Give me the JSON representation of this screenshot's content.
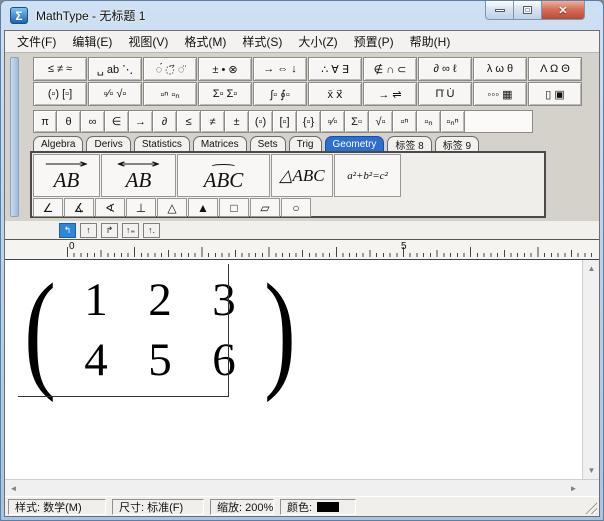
{
  "window": {
    "title": "MathType - 无标题 1"
  },
  "icons": {
    "app": "Σ",
    "close": "✕",
    "scroll_up": "▲",
    "scroll_down": "▼",
    "scroll_left": "◄",
    "scroll_right": "►"
  },
  "menu": {
    "items": [
      "文件(F)",
      "编辑(E)",
      "视图(V)",
      "格式(M)",
      "样式(S)",
      "大小(Z)",
      "预置(P)",
      "帮助(H)"
    ]
  },
  "toolbar": {
    "row1": [
      "≤ ≠ ≈",
      "␣ ab ⋱",
      "◌́ ◌⃗ ◌̈",
      "± • ⊗",
      "→ ⇔ ↓",
      "∴ ∀ ∃",
      "∉ ∩ ⊂",
      "∂ ∞ ℓ",
      "λ ω θ",
      "Λ Ω Θ"
    ],
    "row2": [
      "(▫) [▫]",
      "▫∕▫ √▫",
      "▫ⁿ ▫ₙ",
      "Σ▫ Σ▫",
      "∫▫ ∮▫",
      "x̄ x⃗",
      "→ ⇌",
      "Π̇ U̇",
      "◦◦◦ ▦",
      "▯ ▣"
    ],
    "row3": [
      "π",
      "θ",
      "∞",
      "∈",
      "→",
      "∂",
      "≤",
      "≠",
      "±",
      "(▫)",
      "[▫]",
      "{▫}",
      "▫∕▫",
      "Σ▫",
      "√▫",
      "▫ⁿ",
      "▫ₙ",
      "▫ₙⁿ"
    ],
    "tabs": [
      {
        "label": "Algebra",
        "active": false
      },
      {
        "label": "Derivs",
        "active": false
      },
      {
        "label": "Statistics",
        "active": false
      },
      {
        "label": "Matrices",
        "active": false
      },
      {
        "label": "Sets",
        "active": false
      },
      {
        "label": "Trig",
        "active": false
      },
      {
        "label": "Geometry",
        "active": true
      },
      {
        "label": "标签 8",
        "active": false
      },
      {
        "label": "标签 9",
        "active": false
      }
    ],
    "templates_large": [
      {
        "accent": "⟶",
        "base": "AB"
      },
      {
        "accent": "⟷",
        "base": "AB"
      },
      {
        "accent": "⌢",
        "base": "ABC"
      },
      {
        "accent": "",
        "base": "△ABC"
      },
      {
        "accent": "",
        "base": "a²+b²=c²"
      }
    ],
    "templates_small": [
      "∠",
      "∡",
      "∢",
      "⊥",
      "△",
      "▲",
      "□",
      "▱",
      "○"
    ],
    "tabstops": [
      "↰",
      "↑",
      "↱",
      "↑₌",
      "↑."
    ]
  },
  "ruler": {
    "marks": [
      {
        "label": "0"
      },
      {
        "label": "5"
      }
    ]
  },
  "editor": {
    "matrix": {
      "left_fence": "(",
      "right_fence": ")",
      "cells": [
        [
          "1",
          "2",
          "3"
        ],
        [
          "4",
          "5",
          "6"
        ]
      ]
    }
  },
  "statusbar": {
    "style": "样式: 数学(M)",
    "size": "尺寸: 标准(F)",
    "zoom": "缩放: 200%",
    "color_label": "颜色:",
    "color_value": "#000000"
  },
  "colors": {
    "tab_active": "#2d6fd0",
    "close_button": "#bd4936"
  }
}
